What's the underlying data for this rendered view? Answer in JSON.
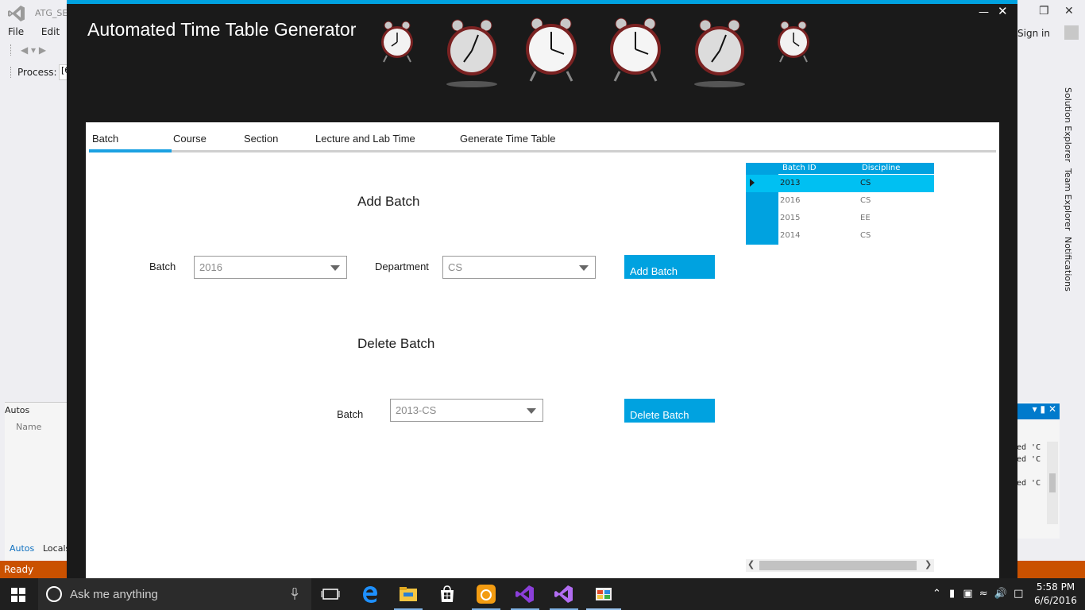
{
  "vs": {
    "title": "ATG_SE",
    "menu": [
      "File",
      "Edit"
    ],
    "process_label": "Process:",
    "process_value": "[6",
    "sign_in": "Sign in",
    "side_tabs": [
      "Solution Explorer",
      "Team Explorer",
      "Notifications"
    ],
    "autos_title": "Autos",
    "autos_column": "Name",
    "autos_tab": "Autos",
    "locals_tab": "Locals",
    "output_lines": [
      "ed 'C",
      "ed 'C",
      "",
      "ed 'C"
    ],
    "status": "Ready"
  },
  "app": {
    "title": "Automated Time Table Generator",
    "tabs": [
      "Batch",
      "Course",
      "Section",
      "Lecture and Lab Time",
      "Generate Time Table"
    ],
    "active_tab": "Batch",
    "add_section": {
      "title": "Add Batch",
      "batch_label": "Batch",
      "batch_value": "2016",
      "department_label": "Department",
      "department_value": "CS",
      "button": "Add Batch"
    },
    "delete_section": {
      "title": "Delete Batch",
      "batch_label": "Batch",
      "batch_value": "2013-CS",
      "button": "Delete Batch"
    },
    "grid": {
      "headers": [
        "Batch ID",
        "Discipline"
      ],
      "rows": [
        {
          "id": "2013",
          "discipline": "CS",
          "selected": true
        },
        {
          "id": "2016",
          "discipline": "CS",
          "selected": false
        },
        {
          "id": "2015",
          "discipline": "EE",
          "selected": false
        },
        {
          "id": "2014",
          "discipline": "CS",
          "selected": false
        }
      ]
    }
  },
  "taskbar": {
    "search_placeholder": "Ask me anything",
    "time": "5:58 PM",
    "date": "6/6/2016"
  },
  "colors": {
    "accent": "#00a2e0",
    "selected_row": "#00c0f2",
    "status_bar": "#ca5100",
    "app_bg": "#1a1a1a"
  }
}
